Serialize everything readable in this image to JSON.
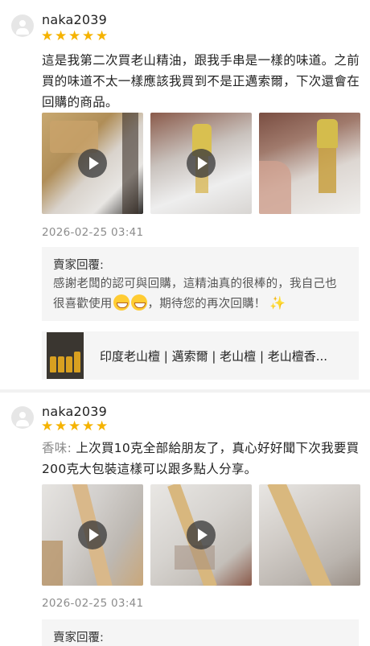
{
  "reviews": [
    {
      "username": "naka2039",
      "rating": 5,
      "text_prefix": "",
      "text": "這是我第二次買老山精油，跟我手串是一樣的味道。之前買的味道不太一樣應該我買到不是正邁索爾，下次還會在回購的商品。",
      "media": [
        {
          "type": "video"
        },
        {
          "type": "video"
        },
        {
          "type": "image"
        }
      ],
      "timestamp": "2026-02-25 03:41",
      "seller_reply": {
        "label": "賣家回覆:",
        "text_before": "感謝老闆的認可與回購，這精油真的很棒的，我自己也很喜歡使用",
        "text_after": "，期待您的再次回購！",
        "emoji_names": [
          "grinning-face-emoji",
          "grinning-face-emoji",
          "sparkles-emoji"
        ]
      },
      "product": {
        "name": "印度老山檀 | 邁索爾 | 老山檀 | 老山檀香..."
      }
    },
    {
      "username": "naka2039",
      "rating": 5,
      "text_prefix": "香味: ",
      "text": "上次買10克全部給朋友了，真心好好聞下次我要買200克大包裝這樣可以跟多點人分享。",
      "media": [
        {
          "type": "video"
        },
        {
          "type": "video"
        },
        {
          "type": "image"
        }
      ],
      "timestamp": "2026-02-25 03:41",
      "seller_reply": {
        "label": "賣家回覆:"
      }
    }
  ],
  "colors": {
    "star": "#f5b300",
    "reply_bg": "#f5f5f5",
    "timestamp": "#8c8c8c"
  }
}
